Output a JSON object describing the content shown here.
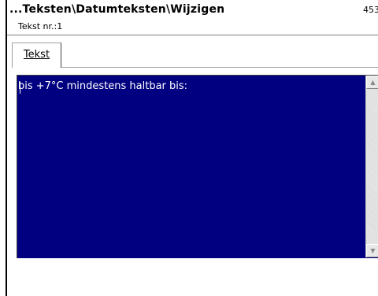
{
  "header": {
    "title": "...Teksten\\Datumteksten\\Wijzigen",
    "subtitle": "Tekst nr.:1",
    "code": "453"
  },
  "tabs": [
    {
      "label": "Tekst"
    }
  ],
  "editor": {
    "text": "bis +7°C mindestens haltbar bis:"
  },
  "scrollbar": {
    "up_icon": "▲",
    "down_icon": "▼"
  }
}
